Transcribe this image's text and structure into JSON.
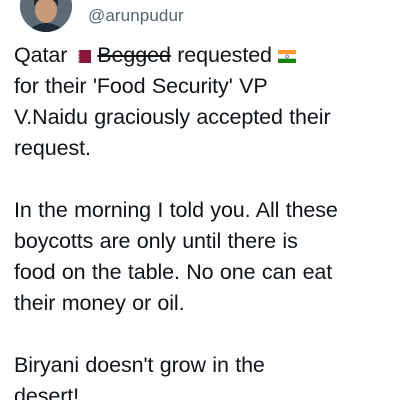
{
  "tweet": {
    "handle": "@arunpudur",
    "line1_a": "Qatar",
    "line1_strike": "Begged",
    "line1_b": "requested",
    "line2": "for their 'Food Security' VP",
    "line3": "V.Naidu graciously accepted their",
    "line4": "request.",
    "para2_l1": "In the morning I told you. All these",
    "para2_l2": "boycotts are only until there is",
    "para2_l3": "food on the table. No one can eat",
    "para2_l4": "their money or oil.",
    "para3_l1": "Biryani doesn't grow in the",
    "para3_l2": "desert!",
    "icons": {
      "qatar_flag": "qatar-flag-icon",
      "india_flag": "india-flag-icon",
      "avatar": "avatar"
    },
    "colors": {
      "handle": "#536471",
      "text": "#0f1419",
      "qatar_maroon": "#8a1538",
      "india_saffron": "#ff9933",
      "india_green": "#138808",
      "india_chakra": "#000080"
    }
  }
}
